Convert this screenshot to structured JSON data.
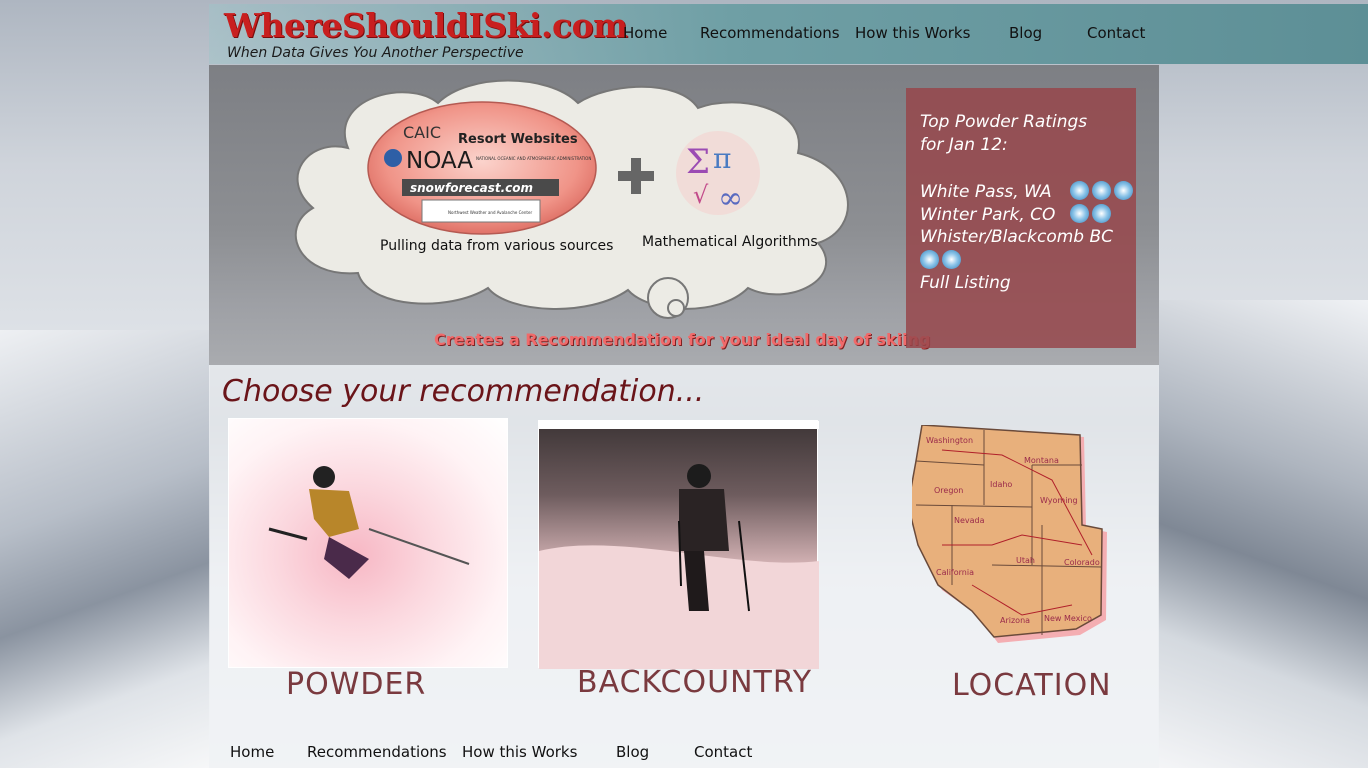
{
  "site": {
    "logo": "WhereShouldISki.com",
    "tagline": "When Data Gives You Another Perspective"
  },
  "nav": [
    "Home",
    "Recommendations",
    "How this Works",
    "Blog",
    "Contact"
  ],
  "hero": {
    "cloud_sources_logos": [
      "CAIC",
      "Resort Websites",
      "NOAA",
      "NATIONAL OCEANIC AND ATMOSPHERIC ADMINISTRATION",
      "snowforecast.com",
      "Northwest Weather and Avalanche Center"
    ],
    "sources_label": "Pulling data from various sources",
    "math_label": "Mathematical Algorithms",
    "caption": "Creates a Recommendation for your ideal day of skiing"
  },
  "ratings": {
    "title_line1": "Top Powder Ratings",
    "title_line2": "for Jan 12:",
    "items": [
      {
        "name": "White Pass, WA",
        "flakes": 3
      },
      {
        "name": "Winter Park, CO",
        "flakes": 2
      },
      {
        "name": "Whister/Blackcomb BC",
        "flakes": 2
      }
    ],
    "full_listing": "Full Listing"
  },
  "recommend": {
    "heading": "Choose your recommendation...",
    "cards": [
      {
        "label": "POWDER",
        "image": "skier-in-powder-photo"
      },
      {
        "label": "BACKCOUNTRY",
        "image": "backcountry-skier-photo"
      },
      {
        "label": "LOCATION",
        "image": "western-us-map"
      }
    ]
  },
  "map_states": [
    "Washington",
    "Montana",
    "Oregon",
    "Idaho",
    "Wyoming",
    "Nevada",
    "Utah",
    "Colorado",
    "California",
    "Arizona",
    "New Mexico"
  ],
  "colors": {
    "logo": "#c81f1f",
    "ratings_panel": "#96464b",
    "heading": "#6a1419",
    "card_label": "#7a3a3f",
    "header_teal": "#5d8f96"
  }
}
